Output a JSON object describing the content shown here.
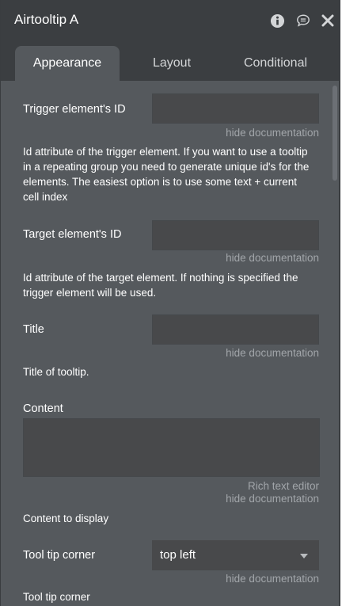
{
  "window": {
    "title": "Airtooltip A",
    "icons": [
      "info-icon",
      "comment-icon",
      "close-icon"
    ]
  },
  "tabs": [
    {
      "label": "Appearance",
      "active": true
    },
    {
      "label": "Layout",
      "active": false
    },
    {
      "label": "Conditional",
      "active": false
    }
  ],
  "fields": {
    "trigger": {
      "label": "Trigger element's ID",
      "value": "",
      "toggle": "hide documentation",
      "doc": "Id attribute of the trigger element. If you want to use a tooltip in a repeating group you need to generate unique id's for the elements. The easiest option is to use some text + current cell index"
    },
    "target": {
      "label": "Target element's ID",
      "value": "",
      "toggle": "hide documentation",
      "doc": "Id attribute of the target element. If nothing is specified the trigger element will be used."
    },
    "title": {
      "label": "Title",
      "value": "",
      "toggle": "hide documentation",
      "doc": "Title of tooltip."
    },
    "content": {
      "label": "Content",
      "value": "",
      "rich_text_link": "Rich text editor",
      "toggle": "hide documentation",
      "doc": "Content to display"
    },
    "corner": {
      "label": "Tool tip corner",
      "selected": "top left",
      "toggle": "hide documentation",
      "doc": "Tool tip corner"
    }
  },
  "colors": {
    "panel_bg": "#55595d",
    "header_bg": "#3b3e41",
    "input_bg": "#48494b",
    "link_text": "#a2a6aa"
  }
}
